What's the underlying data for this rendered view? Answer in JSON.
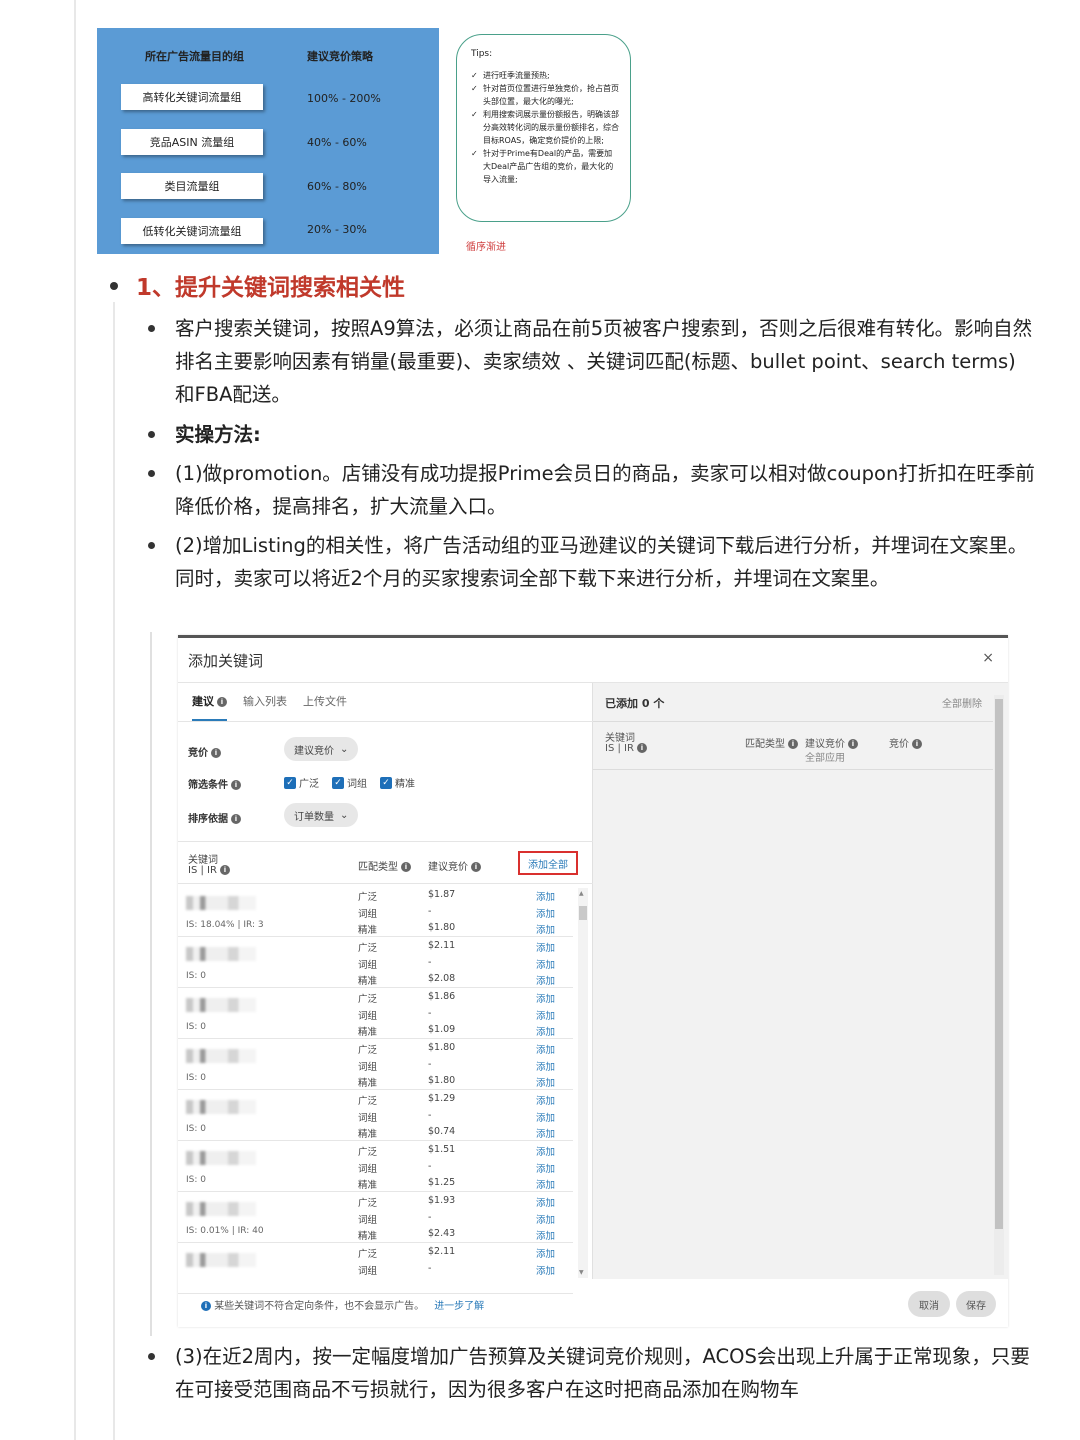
{
  "strategy": {
    "col1_header": "所在广告流量目的组",
    "col2_header": "建议竞价策略",
    "rows": [
      {
        "group": "高转化关键词流量组",
        "bid": "100% - 200%"
      },
      {
        "group": "竞品ASIN 流量组",
        "bid": "40% - 60%"
      },
      {
        "group": "类目流量组",
        "bid": "60% - 80%"
      },
      {
        "group": "低转化关键词流量组",
        "bid": "20% - 30%"
      }
    ],
    "tips_title": "Tips:",
    "tips": [
      "进行旺季流量预热;",
      "针对首页位置进行单独竞价，抢占首页头部位置，最大化的曝光;",
      "利用搜索词展示量份额报告，明确该部分高效转化词的展示量份额排名，综合目标ROAS，确定竞价提价的上限;",
      "针对于Prime有Deal的产品，需要加大Deal产品广告组的竞价，最大化的导入流量;"
    ],
    "step_note": "循序渐进"
  },
  "section": {
    "heading": "1、提升关键词搜索相关性",
    "p1": "客户搜索关键词，按照A9算法，必须让商品在前5页被客户搜索到，否则之后很难有转化。影响自然排名主要影响因素有销量(最重要)、卖家绩效 、关键词匹配(标题、bullet point、search terms)和FBA配送。",
    "p2": "实操方法:",
    "p3": "(1)做promotion。店铺没有成功提报Prime会员日的商品，卖家可以相对做coupon打折扣在旺季前降低价格，提高排名，扩大流量入口。",
    "p4": "(2)增加Listing的相关性，将广告活动组的亚马逊建议的关键词下载后进行分析，并埋词在文案里。同时，卖家可以将近2个月的买家搜索词全部下载下来进行分析，并埋词在文案里。",
    "p5": "(3)在近2周内，按一定幅度增加广告预算及关键词竞价规则，ACOS会出现上升属于正常现象，只要在可接受范围商品不亏损就行，因为很多客户在这时把商品添加在购物车"
  },
  "dialog": {
    "title": "添加关键词",
    "close": "×",
    "tabs": {
      "suggest": "建议",
      "input_list": "输入列表",
      "upload": "上传文件"
    },
    "bid_label": "竞价",
    "bid_value": "建议竞价",
    "filter_label": "筛选条件",
    "filters": [
      "广泛",
      "词组",
      "精准"
    ],
    "sort_label": "排序依据",
    "sort_value": "订单数量",
    "col_keyword": "关键词",
    "col_is_ir": "IS | IR",
    "col_match": "匹配类型",
    "col_sugg_bid": "建议竞价",
    "add_all": "添加全部",
    "add": "添加",
    "rows": [
      {
        "is": "IS: 18.04% | IR: 3",
        "bids": [
          "$1.87",
          "-",
          "$1.80"
        ]
      },
      {
        "is": "IS: 0",
        "bids": [
          "$2.11",
          "-",
          "$2.08"
        ]
      },
      {
        "is": "IS: 0",
        "bids": [
          "$1.86",
          "-",
          "$1.09"
        ]
      },
      {
        "is": "IS: 0",
        "bids": [
          "$1.80",
          "-",
          "$1.80"
        ]
      },
      {
        "is": "IS: 0",
        "bids": [
          "$1.29",
          "-",
          "$0.74"
        ]
      },
      {
        "is": "IS: 0",
        "bids": [
          "$1.51",
          "-",
          "$1.25"
        ]
      },
      {
        "is": "IS: 0.01% | IR: 40",
        "bids": [
          "$1.93",
          "-",
          "$2.43"
        ]
      },
      {
        "is": "",
        "bids": [
          "$2.11",
          "-"
        ]
      }
    ],
    "match_types": [
      "广泛",
      "词组",
      "精准"
    ],
    "right": {
      "added": "已添加 0 个",
      "delete_all": "全部删除",
      "col_keyword": "关键词",
      "col_is_ir": "IS | IR",
      "col_match": "匹配类型",
      "col_sugg_bid": "建议竞价",
      "apply_all": "全部应用",
      "col_bid": "竞价"
    },
    "footer_note": "某些关键词不符合定向条件，也不会显示广告。",
    "learn_more": "进一步了解",
    "cancel": "取消",
    "save": "保存"
  }
}
